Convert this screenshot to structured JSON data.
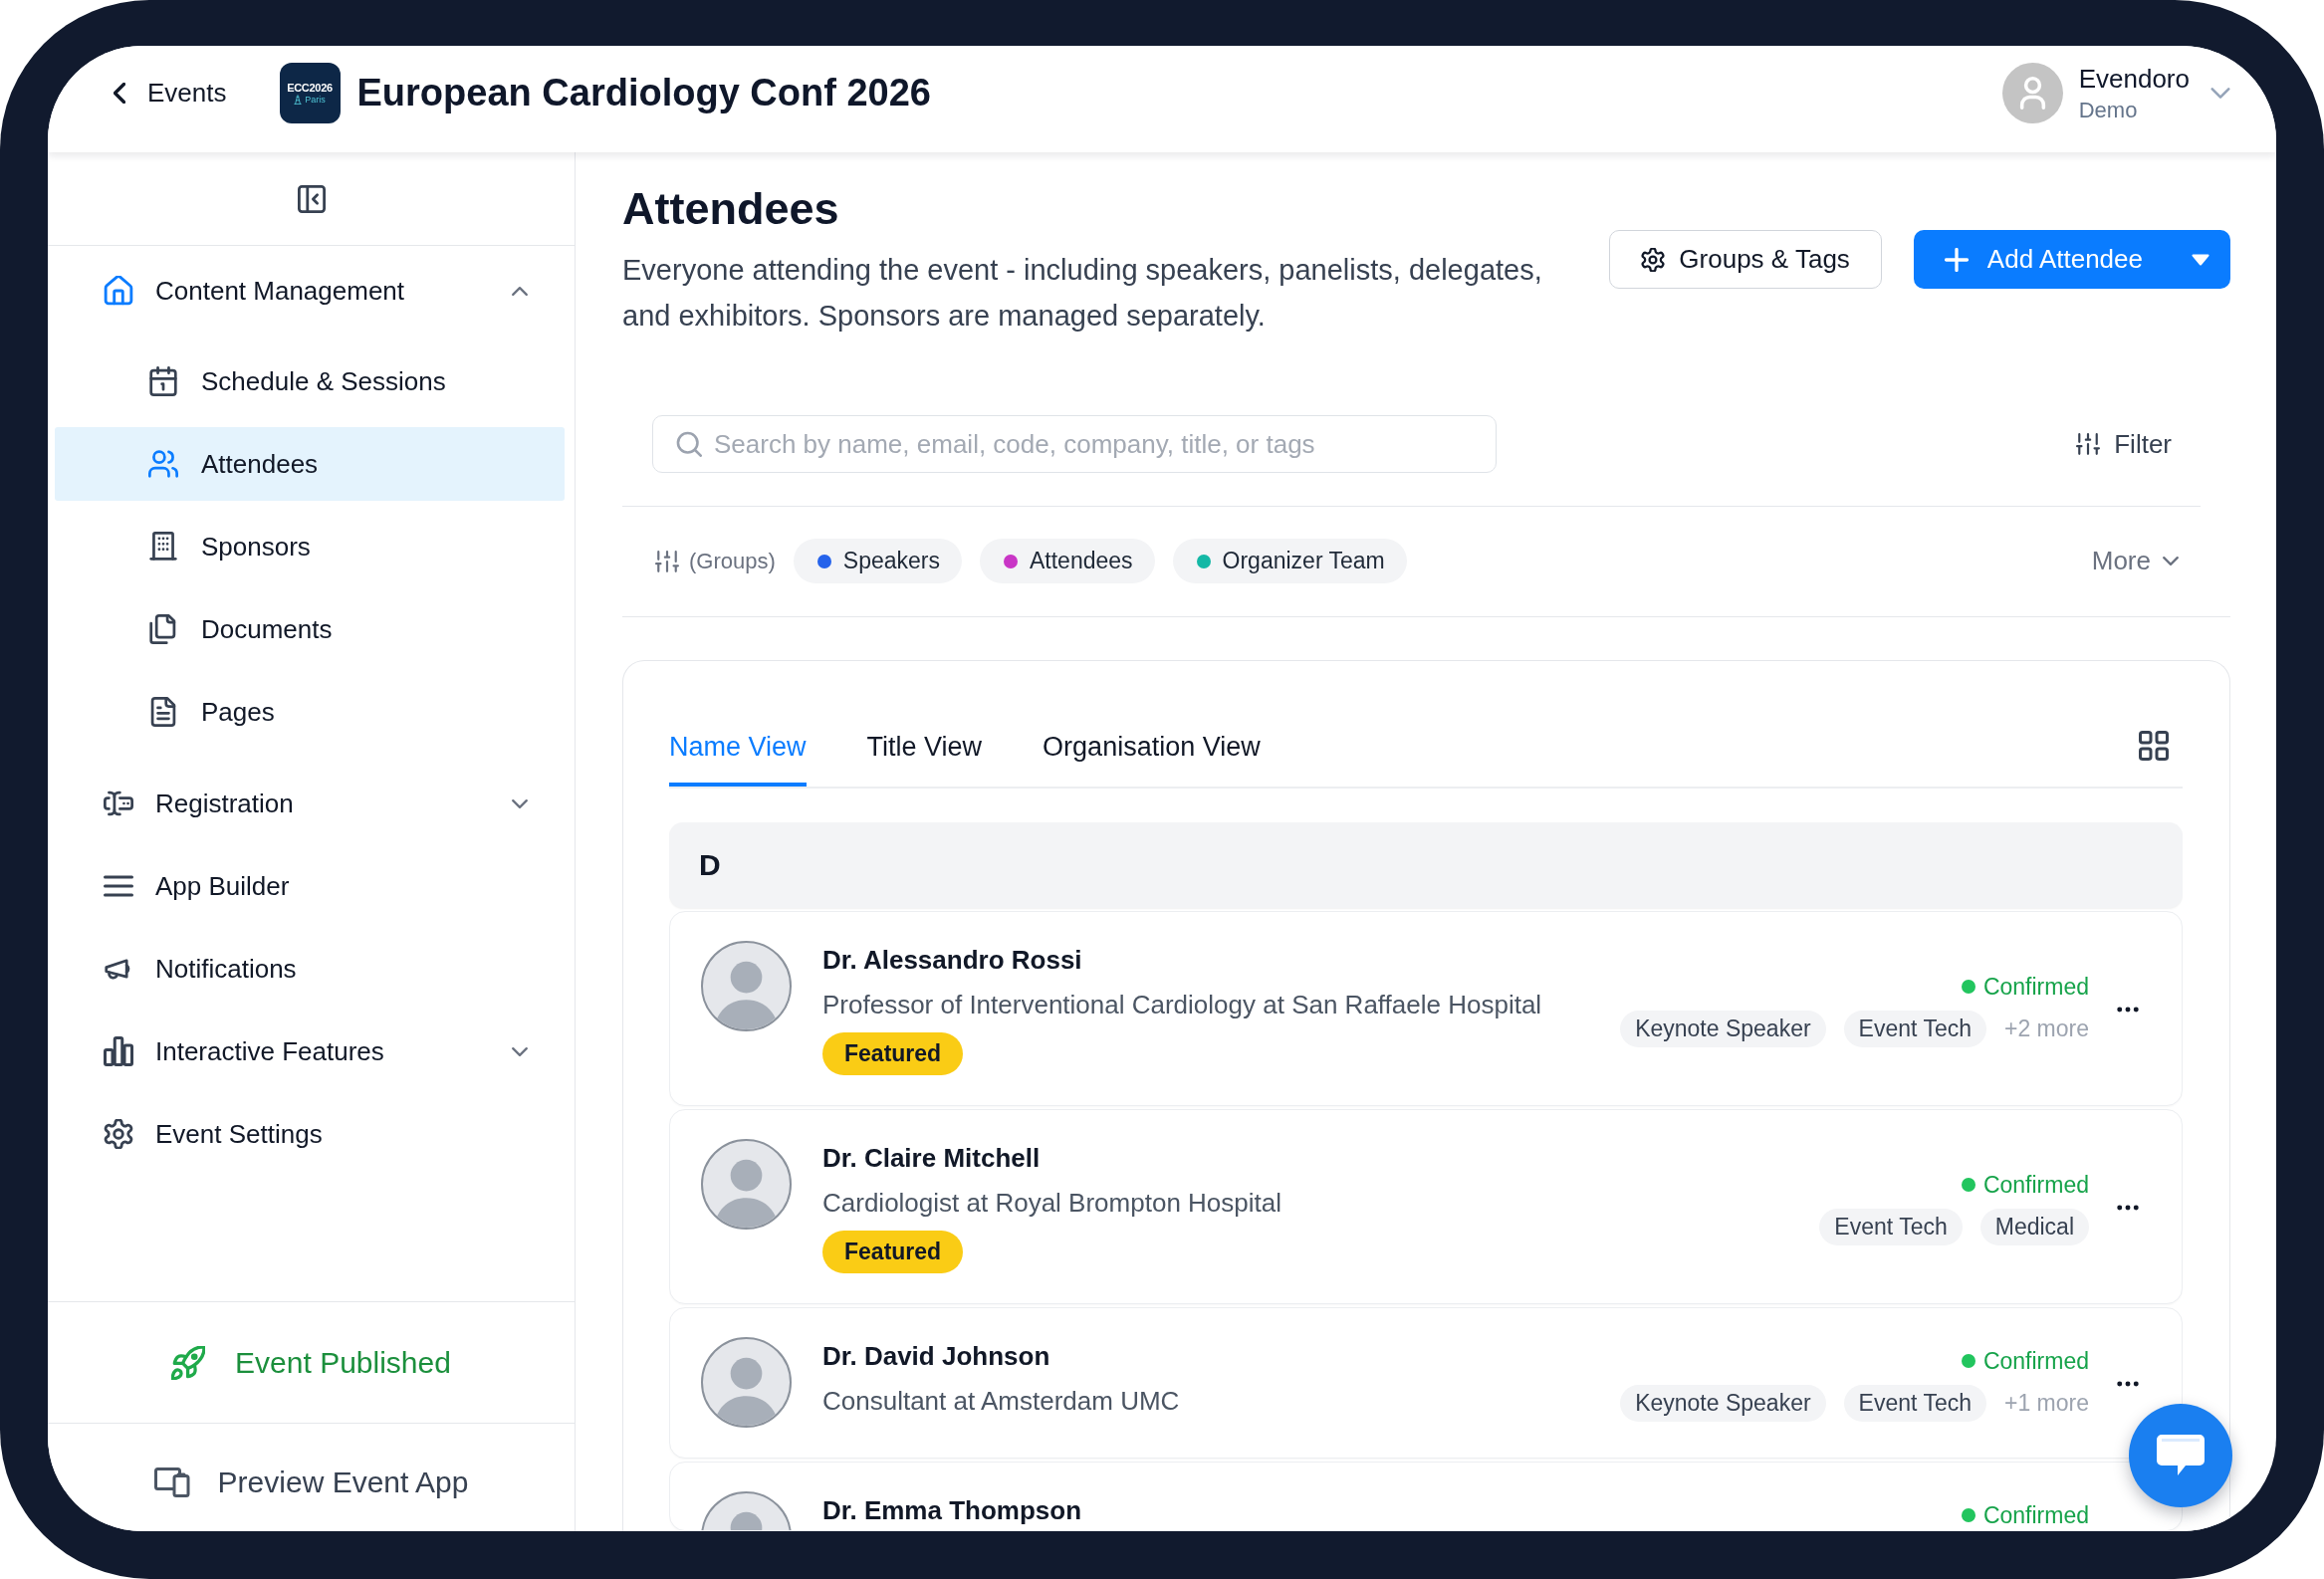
{
  "header": {
    "back_link": "Events",
    "logo": {
      "name": "ECC2026",
      "city": "Paris"
    },
    "title": "European Cardiology Conf 2026",
    "user": {
      "name": "Evendoro",
      "subtitle": "Demo"
    }
  },
  "sidebar": {
    "items": [
      {
        "label": "Content Management",
        "kind": "group",
        "selected": false,
        "expanded": true,
        "children": [
          {
            "label": "Schedule & Sessions",
            "selected": false
          },
          {
            "label": "Attendees",
            "selected": true
          },
          {
            "label": "Sponsors",
            "selected": false
          },
          {
            "label": "Documents",
            "selected": false
          },
          {
            "label": "Pages",
            "selected": false
          }
        ]
      },
      {
        "label": "Registration",
        "kind": "group",
        "selected": false,
        "expanded": false
      },
      {
        "label": "App Builder",
        "kind": "link",
        "selected": false
      },
      {
        "label": "Notifications",
        "kind": "link",
        "selected": false
      },
      {
        "label": "Interactive Features",
        "kind": "group",
        "selected": false,
        "expanded": false
      },
      {
        "label": "Event Settings",
        "kind": "link",
        "selected": false
      }
    ],
    "publish_status": {
      "label": "Event Published",
      "published": true
    },
    "preview_button": "Preview Event App"
  },
  "page": {
    "title": "Attendees",
    "description": "Everyone attending the event - including speakers, panelists, delegates, and exhibitors. Sponsors are managed separately.",
    "groups_button": "Groups & Tags",
    "add_button": "Add Attendee",
    "search": {
      "placeholder": "Search by name, email, code, company, title, or tags"
    },
    "filter_button": "Filter",
    "groups": {
      "label": "(Groups)",
      "chips": [
        {
          "label": "Speakers",
          "color": "#2563eb"
        },
        {
          "label": "Attendees",
          "color": "#c936c6"
        },
        {
          "label": "Organizer Team",
          "color": "#14b8a6"
        }
      ],
      "more": "More"
    }
  },
  "attendee_list": {
    "tabs": [
      {
        "label": "Name View",
        "selected": true
      },
      {
        "label": "Title View",
        "selected": false
      },
      {
        "label": "Organisation View",
        "selected": false
      }
    ],
    "sections": [
      {
        "letter": "D",
        "rows": [
          {
            "name": "Dr. Alessandro Rossi",
            "title": "Professor of Interventional Cardiology at San Raffaele Hospital",
            "badge": "Featured",
            "status": {
              "label": "Confirmed",
              "kind": "confirmed"
            },
            "tags": [
              "Keynote Speaker",
              "Event Tech"
            ],
            "more_tags": "+2 more"
          },
          {
            "name": "Dr. Claire Mitchell",
            "title": "Cardiologist at Royal Brompton Hospital",
            "badge": "Featured",
            "status": {
              "label": "Confirmed",
              "kind": "confirmed"
            },
            "tags": [
              "Event Tech",
              "Medical"
            ]
          },
          {
            "name": "Dr. David Johnson",
            "title": "Consultant at Amsterdam UMC",
            "status": {
              "label": "Confirmed",
              "kind": "confirmed"
            },
            "tags": [
              "Keynote Speaker",
              "Event Tech"
            ],
            "more_tags": "+1 more"
          },
          {
            "name": "Dr. Emma Thompson",
            "status": {
              "label": "Confirmed",
              "kind": "confirmed"
            }
          }
        ]
      }
    ]
  }
}
